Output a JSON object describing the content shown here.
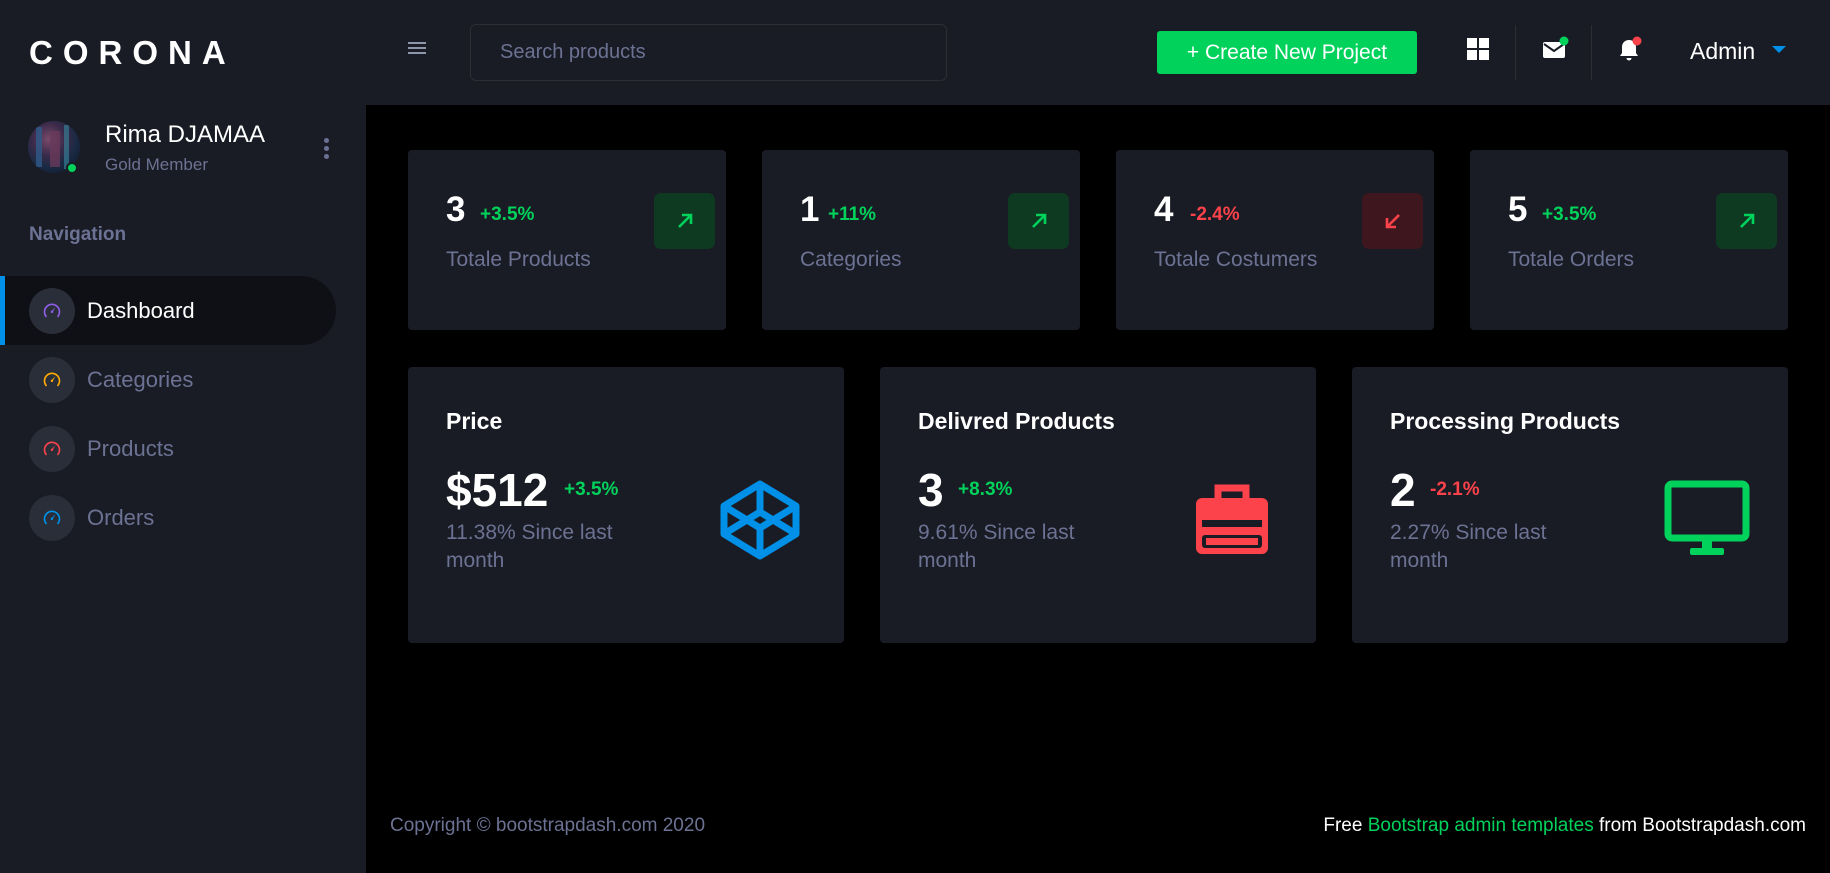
{
  "brand": "CORONA",
  "profile": {
    "name": "Rima DJAMAA",
    "role": "Gold Member"
  },
  "nav": {
    "heading": "Navigation",
    "items": [
      {
        "label": "Dashboard",
        "icon": "speedometer-icon",
        "color": "#8f5fe8",
        "active": true
      },
      {
        "label": "Categories",
        "icon": "speedometer-icon",
        "color": "#ffab00",
        "active": false
      },
      {
        "label": "Products",
        "icon": "speedometer-icon",
        "color": "#fc424a",
        "active": false
      },
      {
        "label": "Orders",
        "icon": "speedometer-icon",
        "color": "#0090e7",
        "active": false
      }
    ]
  },
  "topbar": {
    "search_placeholder": "Search products",
    "create_button": "+ Create New Project",
    "user": "Admin",
    "icons": [
      "grid-icon",
      "mail-icon",
      "bell-icon"
    ]
  },
  "stats": [
    {
      "value": "3",
      "change": "+3.5%",
      "label": "Totale Products",
      "trend": "up"
    },
    {
      "value": "1",
      "change": "+11%",
      "label": "Categories",
      "trend": "up"
    },
    {
      "value": "4",
      "change": "-2.4%",
      "label": "Totale Costumers",
      "trend": "down"
    },
    {
      "value": "5",
      "change": "+3.5%",
      "label": "Totale Orders",
      "trend": "up"
    }
  ],
  "summary": [
    {
      "title": "Price",
      "value": "$512",
      "change": "+3.5%",
      "sub": "11.38% Since last month",
      "icon": "codepen-icon",
      "color": "#0090e7"
    },
    {
      "title": "Delivred Products",
      "value": "3",
      "change": "+8.3%",
      "sub": "9.61% Since last month",
      "icon": "briefcase-icon",
      "color": "#fc424a"
    },
    {
      "title": "Processing Products",
      "value": "2",
      "change": "-2.1%",
      "sub": "2.27% Since last month",
      "icon": "monitor-icon",
      "color": "#00d25b"
    }
  ],
  "footer": {
    "copyright": "Copyright © bootstrapdash.com 2020",
    "free_prefix": "Free",
    "free_link": "Bootstrap admin templates",
    "free_suffix": "from Bootstrapdash.com"
  },
  "colors": {
    "accent_green": "#00d25b",
    "accent_red": "#fc424a",
    "accent_blue": "#0090e7",
    "sidebar_bg": "#191c24",
    "muted_text": "#6c7293"
  }
}
